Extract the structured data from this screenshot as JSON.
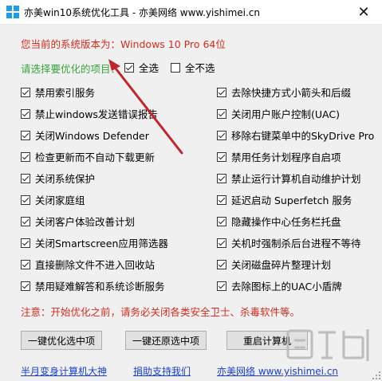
{
  "window": {
    "title": "亦美win10系统优化工具 - 亦美网络 www.yishimei.cn"
  },
  "version_text": "您当前的系统版本为：Windows 10 Pro  64位",
  "prompt_text": "请选择要优化的项目：",
  "select_all_label": "全选",
  "select_none_label": "全不选",
  "options_left": [
    {
      "label": "禁用索引服务",
      "checked": true
    },
    {
      "label": "禁止windows发送错误报告",
      "checked": true
    },
    {
      "label": "关闭Windows Defender",
      "checked": true
    },
    {
      "label": "检查更新而不自动下载更新",
      "checked": true
    },
    {
      "label": "关闭系统保护",
      "checked": true
    },
    {
      "label": "关闭家庭组",
      "checked": true
    },
    {
      "label": "关闭客户体验改善计划",
      "checked": true
    },
    {
      "label": "关闭Smartscreen应用筛选器",
      "checked": true
    },
    {
      "label": "直接删除文件不进入回收站",
      "checked": true
    },
    {
      "label": "禁用疑难解答和系统诊断服务",
      "checked": true
    }
  ],
  "options_right": [
    {
      "label": "去除快捷方式小箭头和后缀",
      "checked": true
    },
    {
      "label": "关闭用户账户控制(UAC)",
      "checked": true
    },
    {
      "label": "移除右键菜单中的SkyDrive Pro",
      "checked": true
    },
    {
      "label": "禁用任务计划程序自启项",
      "checked": true
    },
    {
      "label": "禁止运行计算机自动维护计划",
      "checked": true
    },
    {
      "label": "延迟启动 Superfetch 服务",
      "checked": true
    },
    {
      "label": "隐藏操作中心任务栏托盘",
      "checked": true
    },
    {
      "label": "关机时强制杀后台进程不等待",
      "checked": true
    },
    {
      "label": "关闭磁盘碎片整理计划",
      "checked": true
    },
    {
      "label": "去除图标上的UAC小盾牌",
      "checked": true
    }
  ],
  "warning_text": "注意：开始优化之前，请务必关闭各类安全卫士、杀毒软件等。",
  "buttons": {
    "optimize": "一键优化选中项",
    "restore": "一键还原选中项",
    "restart": "重启计算机"
  },
  "links": {
    "left": "半月变身计算机大神",
    "middle": "捐助支持我们",
    "right": "亦美网络 www.yishimei.cn"
  },
  "watermark_text": "下载吧",
  "colors": {
    "red": "#d52b1e",
    "green": "#35a63a",
    "link": "#1a3fd1",
    "arrow": "#c0262c"
  }
}
